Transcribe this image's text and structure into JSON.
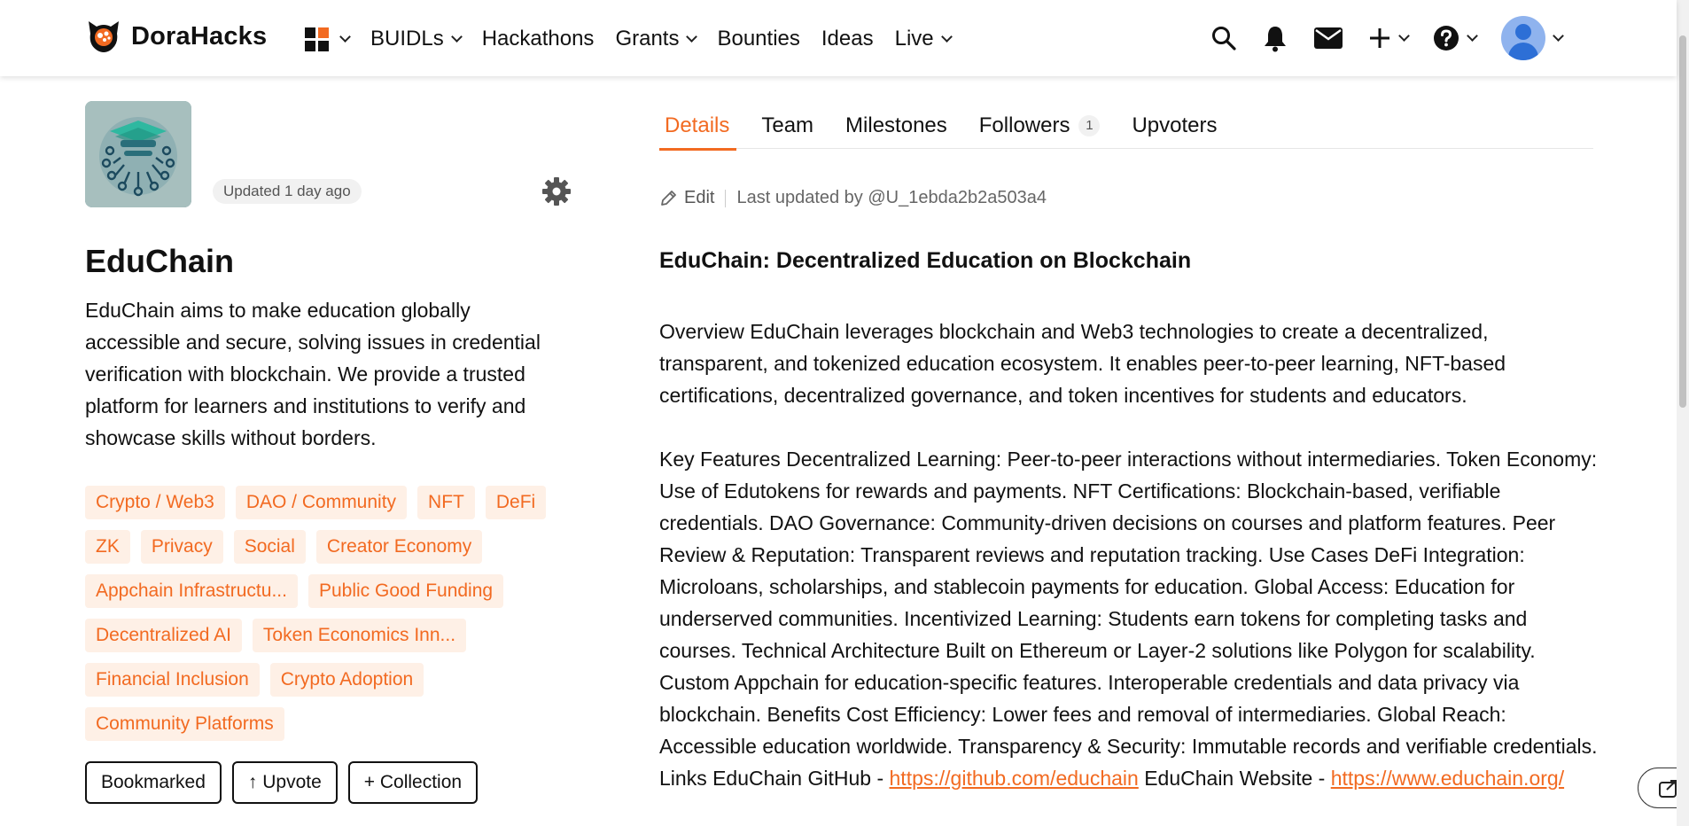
{
  "brand": {
    "name": "DoraHacks",
    "accent": "#f26a21"
  },
  "nav": {
    "items": [
      {
        "label": "BUIDLs",
        "has_menu": true
      },
      {
        "label": "Hackathons",
        "has_menu": false
      },
      {
        "label": "Grants",
        "has_menu": true
      },
      {
        "label": "Bounties",
        "has_menu": false
      },
      {
        "label": "Ideas",
        "has_menu": false
      },
      {
        "label": "Live",
        "has_menu": true
      }
    ],
    "icons": [
      "apps-icon",
      "search-icon",
      "bell-icon",
      "mail-icon",
      "plus-icon",
      "help-icon",
      "avatar"
    ]
  },
  "project": {
    "updated": "Updated 1 day ago",
    "name": "EduChain",
    "description": "EduChain aims to make education globally accessible and secure, solving issues in credential verification with blockchain. We provide a trusted platform for learners and institutions to verify and showcase skills without borders.",
    "tag_rows": [
      [
        "Crypto / Web3",
        "DAO / Community",
        "NFT",
        "DeFi"
      ],
      [
        "ZK",
        "Privacy",
        "Social",
        "Creator Economy"
      ],
      [
        "Appchain Infrastructu...",
        "Public Good Funding"
      ],
      [
        "Decentralized AI",
        "Token Economics Inn..."
      ],
      [
        "Financial Inclusion",
        "Crypto Adoption"
      ],
      [
        "Community Platforms"
      ]
    ],
    "actions": {
      "bookmark": "Bookmarked",
      "upvote": "↑ Upvote",
      "collection": "+ Collection"
    }
  },
  "tabs": [
    {
      "label": "Details",
      "active": true
    },
    {
      "label": "Team",
      "active": false
    },
    {
      "label": "Milestones",
      "active": false
    },
    {
      "label": "Followers",
      "active": false,
      "count": "1"
    },
    {
      "label": "Upvoters",
      "active": false
    }
  ],
  "details": {
    "edit_label": "Edit",
    "last_updated": "Last updated by @U_1ebda2b2a503a4",
    "title": "EduChain: Decentralized Education on Blockchain",
    "overview": "Overview EduChain leverages blockchain and Web3 technologies to create a decentralized, transparent, and tokenized education ecosystem. It enables peer-to-peer learning, NFT-based certifications, decentralized governance, and token incentives for students and educators.",
    "features": "Key Features Decentralized Learning: Peer-to-peer interactions without intermediaries. Token Economy: Use of Edutokens for rewards and payments. NFT Certifications: Blockchain-based, verifiable credentials. DAO Governance: Community-driven decisions on courses and platform features. Peer Review & Reputation: Transparent reviews and reputation tracking. Use Cases DeFi Integration: Microloans, scholarships, and stablecoin payments for education. Global Access: Education for underserved communities. Incentivized Learning: Students earn tokens for completing tasks and courses. Technical Architecture Built on Ethereum or Layer-2 solutions like Polygon for scalability. Custom Appchain for education-specific features. Interoperable credentials and data privacy via blockchain. Benefits Cost Efficiency: Lower fees and removal of intermediaries. Global Reach: Accessible education worldwide. Transparency & Security: Immutable records and verifiable credentials. Links EduChain GitHub -",
    "github_link": "https://github.com/educhain",
    "website_prefix": "EduChain Website -",
    "website_link": "https://www.educhain.org/"
  }
}
